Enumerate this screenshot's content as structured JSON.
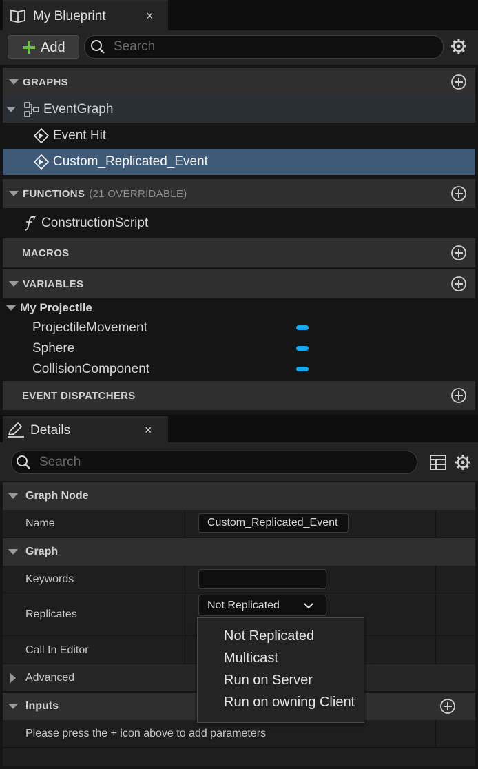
{
  "blueprint_panel": {
    "tab_title": "My Blueprint",
    "close_glyph": "×",
    "add_label": "Add",
    "search_placeholder": "Search",
    "sections": {
      "graphs": {
        "title": "GRAPHS"
      },
      "functions": {
        "title": "FUNCTIONS",
        "subtitle": "(21 OVERRIDABLE)"
      },
      "macros": {
        "title": "MACROS"
      },
      "variables": {
        "title": "VARIABLES"
      },
      "event_dispatchers": {
        "title": "EVENT DISPATCHERS"
      }
    },
    "event_graph": {
      "label": "EventGraph",
      "events": [
        {
          "label": "Event Hit"
        },
        {
          "label": "Custom_Replicated_Event"
        }
      ]
    },
    "functions": [
      {
        "label": "ConstructionScript"
      }
    ],
    "variable_category": {
      "label": "My Projectile",
      "items": [
        {
          "label": "ProjectileMovement"
        },
        {
          "label": "Sphere"
        },
        {
          "label": "CollisionComponent"
        }
      ]
    }
  },
  "details_panel": {
    "tab_title": "Details",
    "close_glyph": "×",
    "search_placeholder": "Search",
    "graph_node_section": {
      "title": "Graph Node",
      "name_label": "Name",
      "name_value": "Custom_Replicated_Event"
    },
    "graph_section": {
      "title": "Graph",
      "keywords_label": "Keywords",
      "keywords_value": "",
      "replicates_label": "Replicates",
      "replicates_value": "Not Replicated",
      "call_in_editor_label": "Call In Editor",
      "advanced_label": "Advanced"
    },
    "inputs_section": {
      "title": "Inputs",
      "hint": "Please press the + icon above to add parameters"
    },
    "replicates_options": [
      "Not Replicated",
      "Multicast",
      "Run on Server",
      "Run on owning Client"
    ]
  },
  "colors": {
    "selected_row": "#3f5a77",
    "variable_pill": "#18a8ee",
    "add_plus": "#6cc04a"
  }
}
